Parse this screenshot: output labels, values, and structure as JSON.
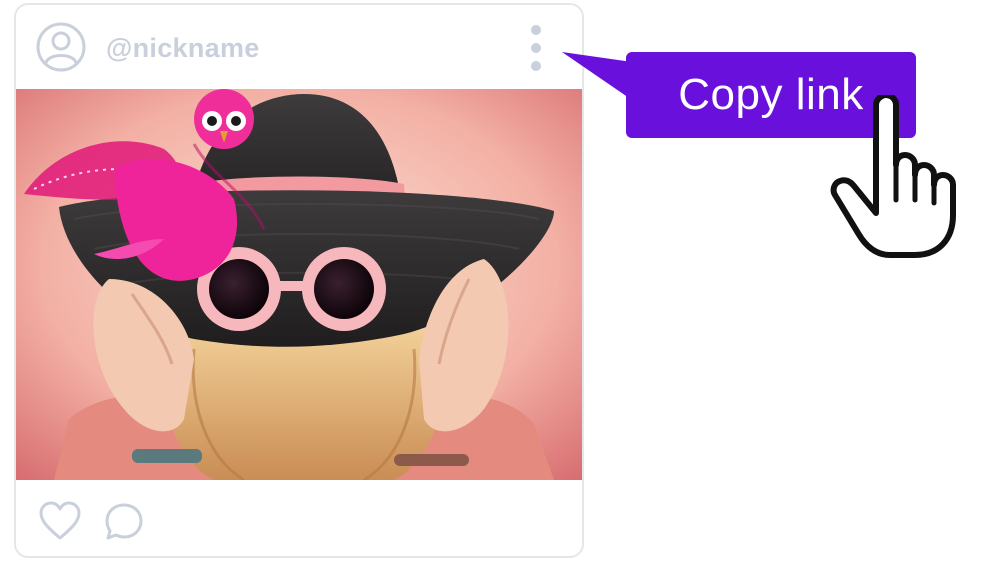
{
  "post": {
    "nickname": "@nickname",
    "icons": {
      "avatar": "user-avatar-icon",
      "more": "vertical-ellipsis-icon",
      "like": "heart-icon",
      "comment": "speech-bubble-icon"
    },
    "image": {
      "subject": "woman-in-black-hat-with-pink-sunglasses-and-feather-bird"
    }
  },
  "tooltip": {
    "label": "Copy link"
  },
  "cursor": {
    "icon": "pointing-hand-cursor-icon"
  },
  "colors": {
    "accent": "#6a10dc",
    "icon_gray": "#c9cfdb",
    "card_border": "#e3e6eb",
    "tooltip_text": "#ffffff"
  }
}
